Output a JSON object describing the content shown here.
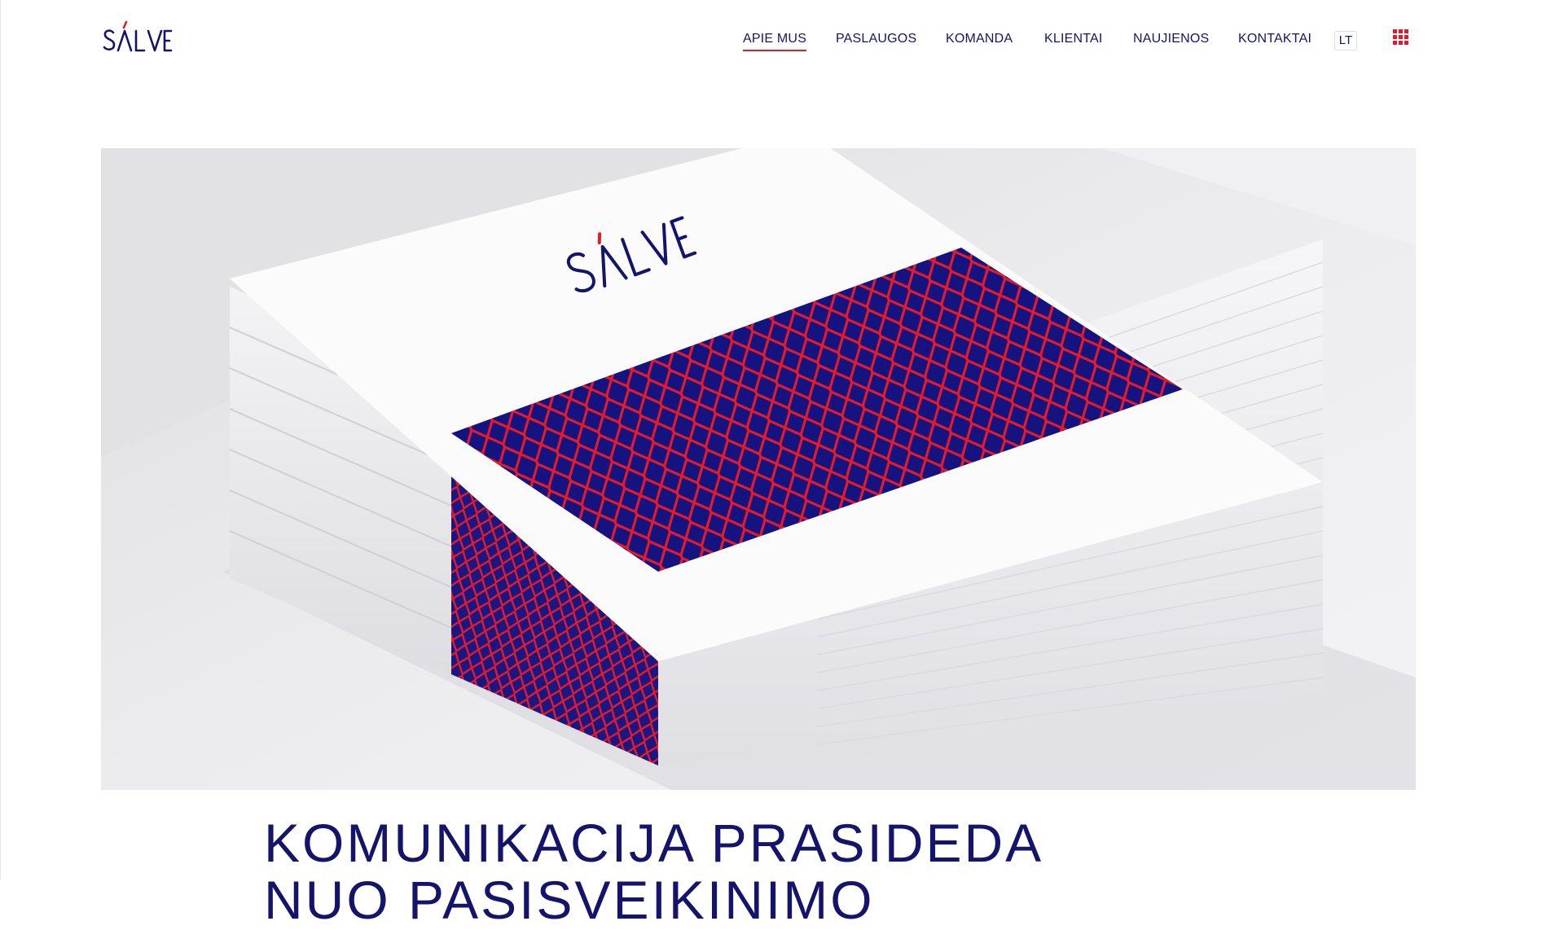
{
  "brand": {
    "logo_text": "SALVE",
    "accent_color": "#e41b2a",
    "primary_color": "#14146b"
  },
  "nav": {
    "items": [
      {
        "label": "APIE MUS",
        "active": true
      },
      {
        "label": "PASLAUGOS",
        "active": false
      },
      {
        "label": "KOMANDA",
        "active": false
      },
      {
        "label": "KLIENTAI",
        "active": false
      },
      {
        "label": "NAUJIENOS",
        "active": false
      },
      {
        "label": "KONTAKTAI",
        "active": false
      }
    ],
    "language": "LT",
    "menu_icon": "grid-icon"
  },
  "hero": {
    "image_subject": "stack of white business cards with blue and red lattice pattern and SALVE logo",
    "cover_logo_text": "SALVE",
    "pattern_colors": [
      "#14137f",
      "#e41b2a"
    ]
  },
  "headline": "KOMUNIKACIJA PRASIDEDA\nNUO PASISVEIKINIMO"
}
